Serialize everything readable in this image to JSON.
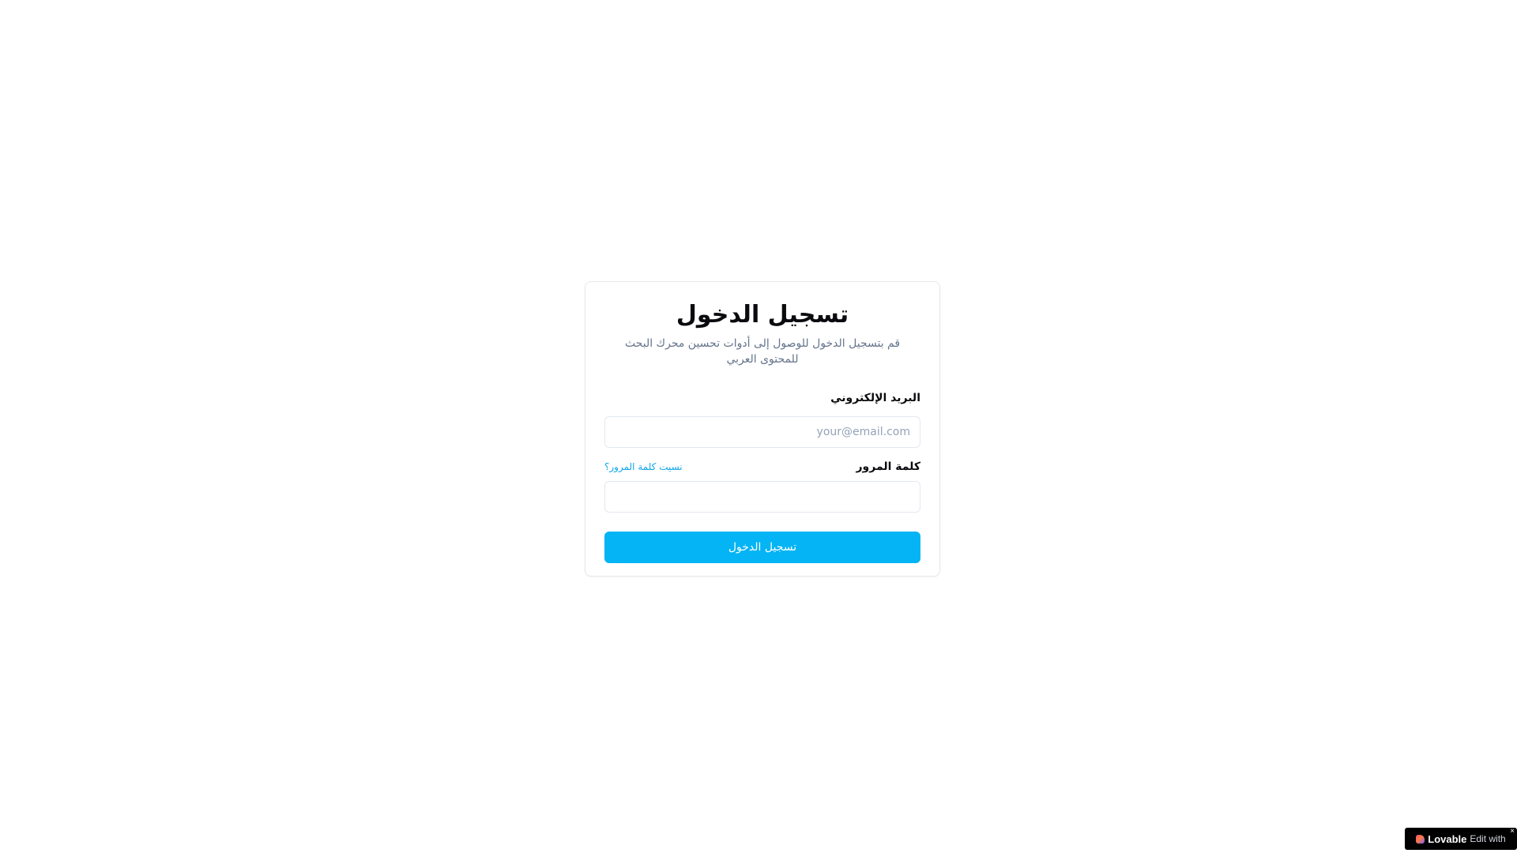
{
  "login": {
    "title": "تسجيل الدخول",
    "subtitle": "قم بتسجيل الدخول للوصول إلى أدوات تحسين محرك البحث للمحتوى العربي",
    "email_label": "البريد الإلكتروني",
    "email_placeholder": "your@email.com",
    "email_value": "",
    "password_label": "كلمة المرور",
    "forgot_password": "نسيت كلمة المرور؟",
    "password_value": "",
    "submit_label": "تسجيل الدخول"
  },
  "badge": {
    "edit_text": "Edit with",
    "brand": "Lovable",
    "close": "×",
    "icon": "lovable-heart-icon"
  },
  "colors": {
    "primary": "#04b4f4",
    "link": "#0ea5e9",
    "muted_text": "#64748b",
    "border": "#e2e8f0"
  }
}
